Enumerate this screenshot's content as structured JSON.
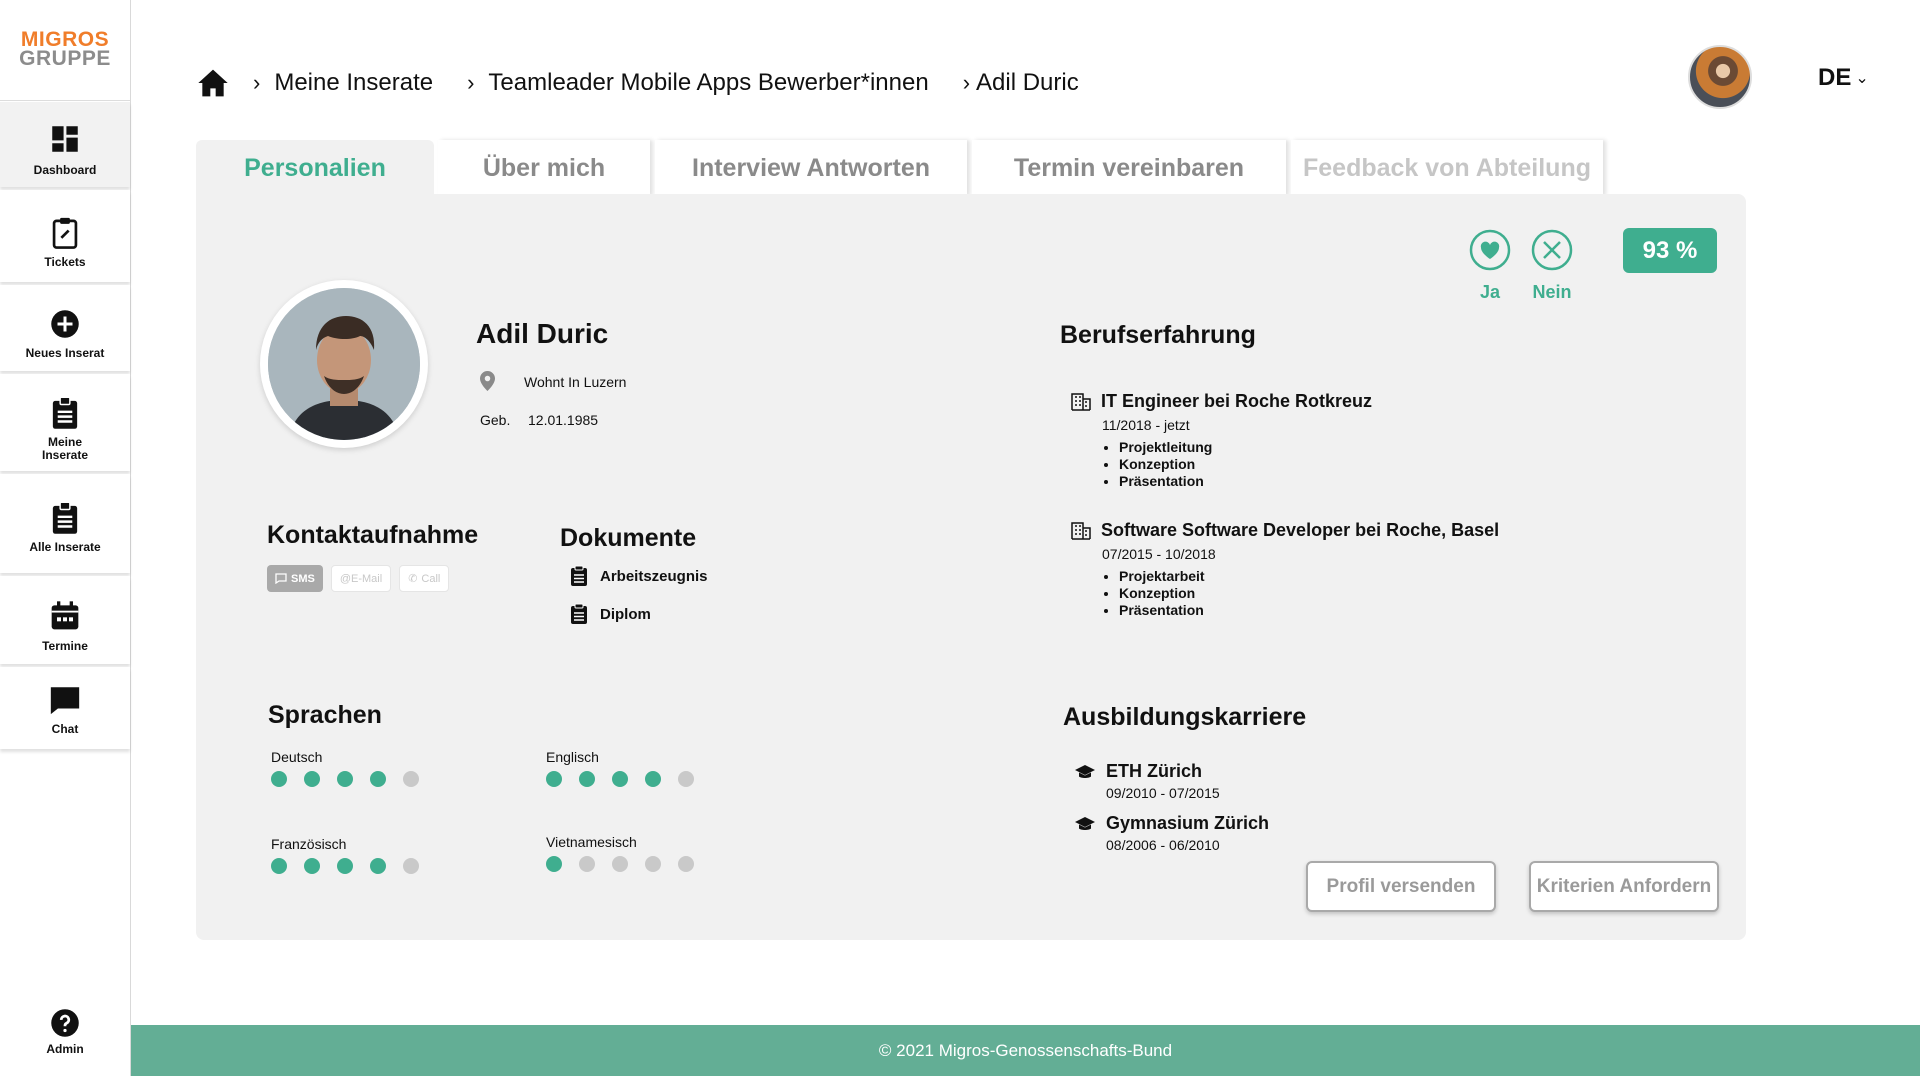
{
  "brand": {
    "line1": "MIGROS",
    "line2": "GRUPPE"
  },
  "sidebar": {
    "items": [
      {
        "label": "Dashboard"
      },
      {
        "label": "Tickets"
      },
      {
        "label": "Neues Inserat"
      },
      {
        "label": "Meine Inserate"
      },
      {
        "label": "Alle Inserate"
      },
      {
        "label": "Termine"
      },
      {
        "label": "Chat"
      }
    ],
    "admin": "Admin"
  },
  "breadcrumb": {
    "items": [
      "Meine Inserate",
      "Teamleader Mobile Apps Bewerber*innen",
      "Adil Duric"
    ]
  },
  "header": {
    "language": "DE"
  },
  "tabs": [
    {
      "label": "Personalien",
      "state": "active"
    },
    {
      "label": "Über mich",
      "state": "normal"
    },
    {
      "label": "Interview Antworten",
      "state": "normal"
    },
    {
      "label": "Termin vereinbaren",
      "state": "normal"
    },
    {
      "label": "Feedback von Abteilung",
      "state": "disabled"
    }
  ],
  "candidate": {
    "name": "Adil Duric",
    "location": "Wohnt In Luzern",
    "birth_label": "Geb.",
    "birth_date": "12.01.1985"
  },
  "decision": {
    "yes": "Ja",
    "no": "Nein",
    "score": "93 %"
  },
  "contact": {
    "title": "Kontaktaufnahme",
    "sms": "SMS",
    "email": "@E-Mail",
    "call": "Call"
  },
  "documents": {
    "title": "Dokumente",
    "items": [
      "Arbeitszeugnis",
      "Diplom"
    ]
  },
  "languages": {
    "title": "Sprachen",
    "items": [
      {
        "name": "Deutsch",
        "level": 4,
        "max": 5
      },
      {
        "name": "Englisch",
        "level": 4,
        "max": 5
      },
      {
        "name": "Französisch",
        "level": 4,
        "max": 5
      },
      {
        "name": "Vietnamesisch",
        "level": 1,
        "max": 5
      }
    ]
  },
  "experience": {
    "title": "Berufserfahrung",
    "jobs": [
      {
        "title": "IT Engineer bei Roche Rotkreuz",
        "period": "11/2018 - jetzt",
        "tasks": [
          "Projektleitung",
          "Konzeption",
          "Präsentation"
        ]
      },
      {
        "title": "Software Software Developer bei Roche, Basel",
        "period": "07/2015 - 10/2018",
        "tasks": [
          "Projektarbeit",
          "Konzeption",
          "Präsentation"
        ]
      }
    ]
  },
  "education": {
    "title": "Ausbildungskarriere",
    "items": [
      {
        "school": "ETH Zürich",
        "period": "09/2010 - 07/2015"
      },
      {
        "school": "Gymnasium Zürich",
        "period": "08/2006 - 06/2010"
      }
    ]
  },
  "actions": {
    "send_profile": "Profil versenden",
    "request_criteria": "Kriterien Anfordern"
  },
  "footer": {
    "text": "© 2021 Migros-Genossenschafts-Bund"
  },
  "colors": {
    "accent": "#3fae8f",
    "footer": "#63ae95",
    "brand_orange": "#f07d2a"
  }
}
